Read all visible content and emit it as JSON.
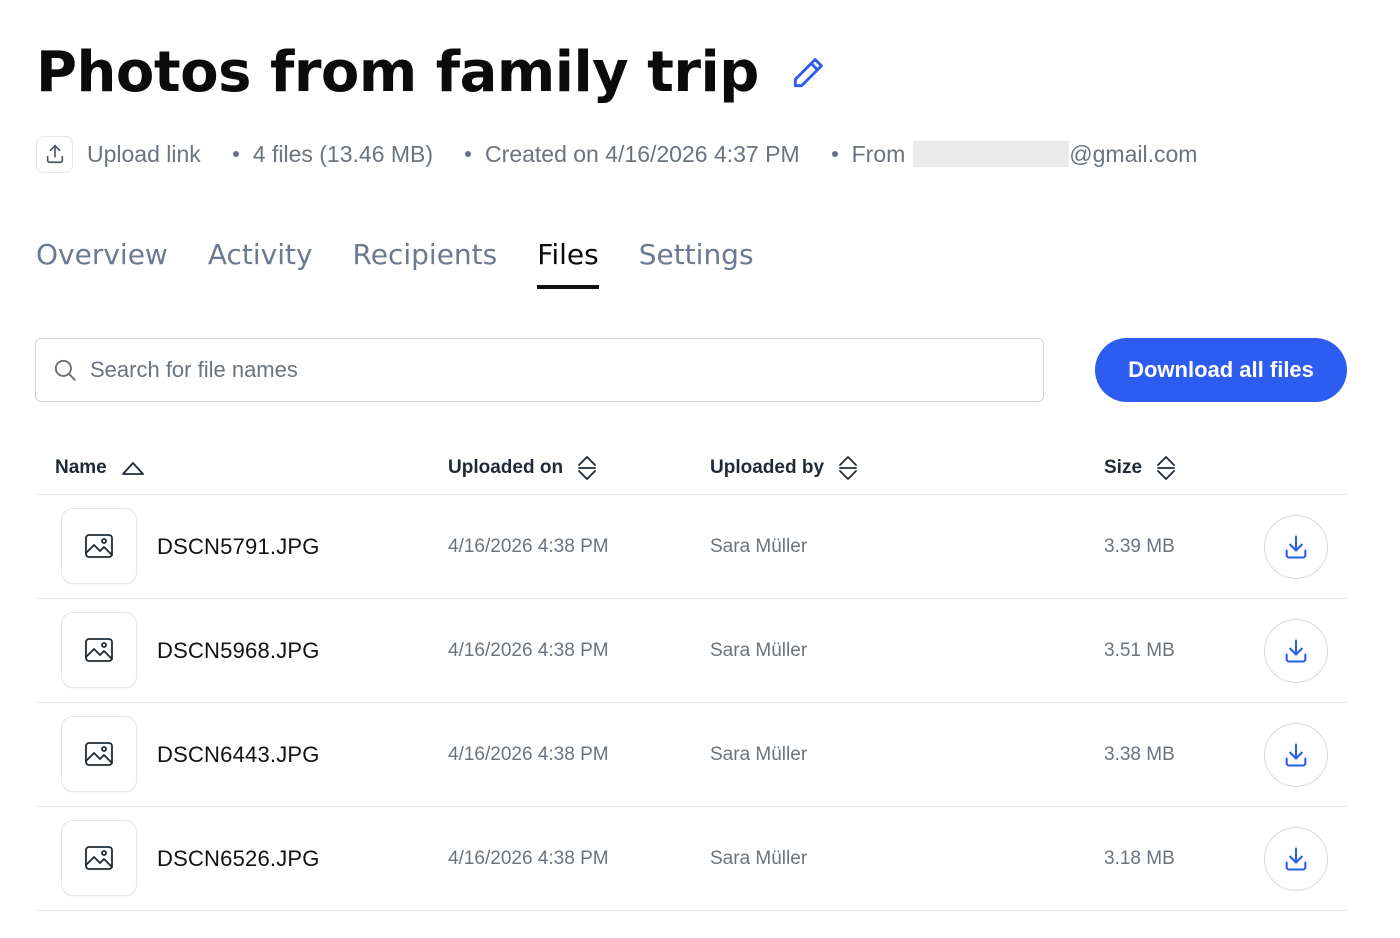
{
  "header": {
    "title": "Photos from family trip"
  },
  "meta": {
    "type_label": "Upload link",
    "files_summary": "4 files (13.46 MB)",
    "created": "Created on 4/16/2026 4:37 PM",
    "from_label": "From",
    "from_email_suffix": "@gmail.com"
  },
  "tabs": [
    {
      "label": "Overview",
      "active": false
    },
    {
      "label": "Activity",
      "active": false
    },
    {
      "label": "Recipients",
      "active": false
    },
    {
      "label": "Files",
      "active": true
    },
    {
      "label": "Settings",
      "active": false
    }
  ],
  "search": {
    "placeholder": "Search for file names",
    "value": ""
  },
  "actions": {
    "download_all_label": "Download all files"
  },
  "table": {
    "columns": {
      "name": "Name",
      "uploaded_on": "Uploaded on",
      "uploaded_by": "Uploaded by",
      "size": "Size"
    },
    "sort": {
      "column": "name",
      "direction": "ascending"
    },
    "rows": [
      {
        "name": "DSCN5791.JPG",
        "uploaded_on": "4/16/2026 4:38 PM",
        "uploaded_by": "Sara Müller",
        "size": "3.39 MB"
      },
      {
        "name": "DSCN5968.JPG",
        "uploaded_on": "4/16/2026 4:38 PM",
        "uploaded_by": "Sara Müller",
        "size": "3.51 MB"
      },
      {
        "name": "DSCN6443.JPG",
        "uploaded_on": "4/16/2026 4:38 PM",
        "uploaded_by": "Sara Müller",
        "size": "3.38 MB"
      },
      {
        "name": "DSCN6526.JPG",
        "uploaded_on": "4/16/2026 4:38 PM",
        "uploaded_by": "Sara Müller",
        "size": "3.18 MB"
      }
    ]
  },
  "icons": {
    "edit": "pencil-icon",
    "upload": "upload-icon",
    "search": "search-icon",
    "file": "image-icon",
    "download": "download-icon",
    "sort_asc": "sort-ascending-icon",
    "sort_both": "sort-icon"
  },
  "colors": {
    "accent": "#2f5cf0",
    "muted_text": "#6b7280",
    "border": "#e5e7eb"
  }
}
